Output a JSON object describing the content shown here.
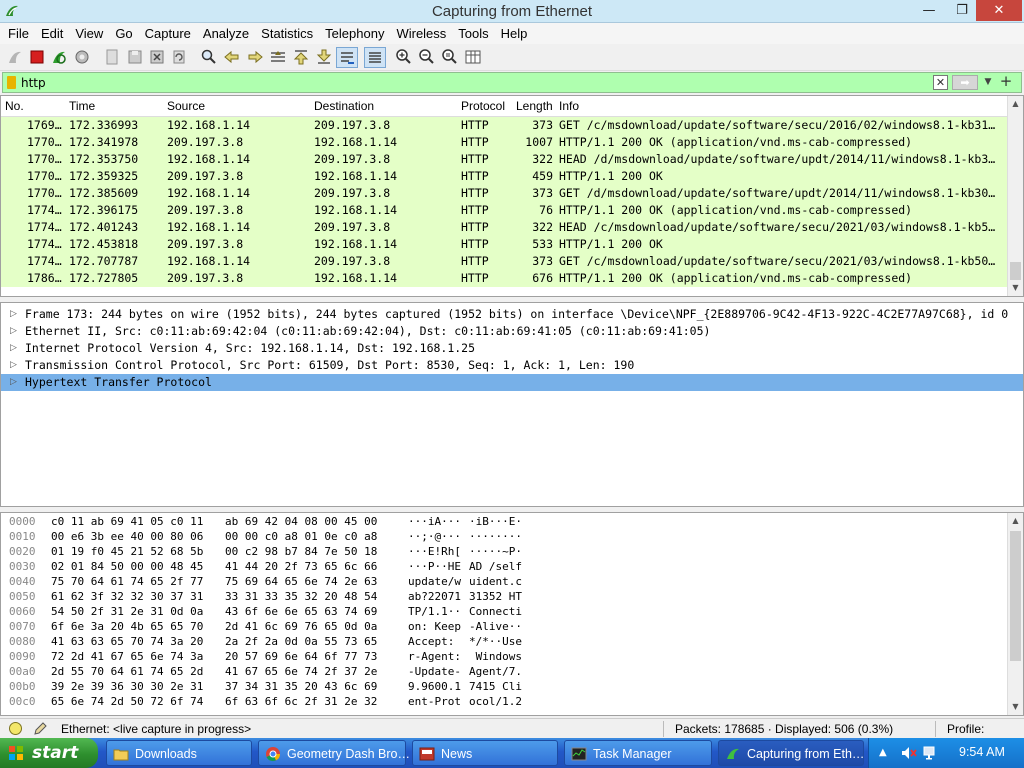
{
  "window": {
    "title": "Capturing from Ethernet",
    "min": "—",
    "max": "❐",
    "close": "✕"
  },
  "menu": [
    "File",
    "Edit",
    "View",
    "Go",
    "Capture",
    "Analyze",
    "Statistics",
    "Telephony",
    "Wireless",
    "Tools",
    "Help"
  ],
  "filter": {
    "value": "http",
    "clear": "✕",
    "apply": "➡",
    "dropdown": "▼",
    "add": "+"
  },
  "columns": {
    "no": "No.",
    "time": "Time",
    "source": "Source",
    "destination": "Destination",
    "protocol": "Protocol",
    "length": "Length",
    "info": "Info"
  },
  "packets": [
    {
      "no": "1769…",
      "time": "172.336993",
      "src": "192.168.1.14",
      "dst": "209.197.3.8",
      "proto": "HTTP",
      "len": "373",
      "info": "GET /c/msdownload/update/software/secu/2016/02/windows8.1-kb31…"
    },
    {
      "no": "1770…",
      "time": "172.341978",
      "src": "209.197.3.8",
      "dst": "192.168.1.14",
      "proto": "HTTP",
      "len": "1007",
      "info": "HTTP/1.1 200 OK  (application/vnd.ms-cab-compressed)"
    },
    {
      "no": "1770…",
      "time": "172.353750",
      "src": "192.168.1.14",
      "dst": "209.197.3.8",
      "proto": "HTTP",
      "len": "322",
      "info": "HEAD /d/msdownload/update/software/updt/2014/11/windows8.1-kb3…"
    },
    {
      "no": "1770…",
      "time": "172.359325",
      "src": "209.197.3.8",
      "dst": "192.168.1.14",
      "proto": "HTTP",
      "len": "459",
      "info": "HTTP/1.1 200 OK"
    },
    {
      "no": "1770…",
      "time": "172.385609",
      "src": "192.168.1.14",
      "dst": "209.197.3.8",
      "proto": "HTTP",
      "len": "373",
      "info": "GET /d/msdownload/update/software/updt/2014/11/windows8.1-kb30…"
    },
    {
      "no": "1774…",
      "time": "172.396175",
      "src": "209.197.3.8",
      "dst": "192.168.1.14",
      "proto": "HTTP",
      "len": "76",
      "info": "HTTP/1.1 200 OK  (application/vnd.ms-cab-compressed)"
    },
    {
      "no": "1774…",
      "time": "172.401243",
      "src": "192.168.1.14",
      "dst": "209.197.3.8",
      "proto": "HTTP",
      "len": "322",
      "info": "HEAD /c/msdownload/update/software/secu/2021/03/windows8.1-kb5…"
    },
    {
      "no": "1774…",
      "time": "172.453818",
      "src": "209.197.3.8",
      "dst": "192.168.1.14",
      "proto": "HTTP",
      "len": "533",
      "info": "HTTP/1.1 200 OK"
    },
    {
      "no": "1774…",
      "time": "172.707787",
      "src": "192.168.1.14",
      "dst": "209.197.3.8",
      "proto": "HTTP",
      "len": "373",
      "info": "GET /c/msdownload/update/software/secu/2021/03/windows8.1-kb50…"
    },
    {
      "no": "1786…",
      "time": "172.727805",
      "src": "209.197.3.8",
      "dst": "192.168.1.14",
      "proto": "HTTP",
      "len": "676",
      "info": "HTTP/1.1 200 OK  (application/vnd.ms-cab-compressed)"
    }
  ],
  "details": [
    {
      "arrow": "▷",
      "text": "Frame 173: 244 bytes on wire (1952 bits), 244 bytes captured (1952 bits) on interface \\Device\\NPF_{2E889706-9C42-4F13-922C-4C2E77A97C68}, id 0",
      "selected": false
    },
    {
      "arrow": "▷",
      "text": "Ethernet II, Src: c0:11:ab:69:42:04 (c0:11:ab:69:42:04), Dst: c0:11:ab:69:41:05 (c0:11:ab:69:41:05)",
      "selected": false
    },
    {
      "arrow": "▷",
      "text": "Internet Protocol Version 4, Src: 192.168.1.14, Dst: 192.168.1.25",
      "selected": false
    },
    {
      "arrow": "▷",
      "text": "Transmission Control Protocol, Src Port: 61509, Dst Port: 8530, Seq: 1, Ack: 1, Len: 190",
      "selected": false
    },
    {
      "arrow": "▷",
      "text": "Hypertext Transfer Protocol",
      "selected": true
    }
  ],
  "hex": [
    {
      "off": "0000",
      "h1": "c0 11 ab 69 41 05 c0 11",
      "h2": "ab 69 42 04 08 00 45 00",
      "a1": "···iA···",
      "a2": "·iB···E·"
    },
    {
      "off": "0010",
      "h1": "00 e6 3b ee 40 00 80 06",
      "h2": "00 00 c0 a8 01 0e c0 a8",
      "a1": "··;·@···",
      "a2": "········"
    },
    {
      "off": "0020",
      "h1": "01 19 f0 45 21 52 68 5b",
      "h2": "00 c2 98 b7 84 7e 50 18",
      "a1": "···E!Rh[",
      "a2": "·····~P·"
    },
    {
      "off": "0030",
      "h1": "02 01 84 50 00 00 48 45",
      "h2": "41 44 20 2f 73 65 6c 66",
      "a1": "···P··HE",
      "a2": "AD /self"
    },
    {
      "off": "0040",
      "h1": "75 70 64 61 74 65 2f 77",
      "h2": "75 69 64 65 6e 74 2e 63",
      "a1": "update/w",
      "a2": "uident.c"
    },
    {
      "off": "0050",
      "h1": "61 62 3f 32 32 30 37 31",
      "h2": "33 31 33 35 32 20 48 54",
      "a1": "ab?22071",
      "a2": "31352 HT"
    },
    {
      "off": "0060",
      "h1": "54 50 2f 31 2e 31 0d 0a",
      "h2": "43 6f 6e 6e 65 63 74 69",
      "a1": "TP/1.1··",
      "a2": "Connecti"
    },
    {
      "off": "0070",
      "h1": "6f 6e 3a 20 4b 65 65 70",
      "h2": "2d 41 6c 69 76 65 0d 0a",
      "a1": "on: Keep",
      "a2": "-Alive··"
    },
    {
      "off": "0080",
      "h1": "41 63 63 65 70 74 3a 20",
      "h2": "2a 2f 2a 0d 0a 55 73 65",
      "a1": "Accept: ",
      "a2": "*/*··Use"
    },
    {
      "off": "0090",
      "h1": "72 2d 41 67 65 6e 74 3a",
      "h2": "20 57 69 6e 64 6f 77 73",
      "a1": "r-Agent:",
      "a2": " Windows"
    },
    {
      "off": "00a0",
      "h1": "2d 55 70 64 61 74 65 2d",
      "h2": "41 67 65 6e 74 2f 37 2e",
      "a1": "-Update-",
      "a2": "Agent/7."
    },
    {
      "off": "00b0",
      "h1": "39 2e 39 36 30 30 2e 31",
      "h2": "37 34 31 35 20 43 6c 69",
      "a1": "9.9600.1",
      "a2": "7415 Cli"
    },
    {
      "off": "00c0",
      "h1": "65 6e 74 2d 50 72 6f 74",
      "h2": "6f 63 6f 6c 2f 31 2e 32",
      "a1": "ent-Prot",
      "a2": "ocol/1.2"
    }
  ],
  "status": {
    "interface": "Ethernet: <live capture in progress>",
    "packets": "Packets: 178685 · Displayed: 506 (0.3%)",
    "profile": "Profile: Default"
  },
  "taskbar": {
    "start": "start",
    "tasks": [
      "Downloads",
      "Geometry Dash Bro…",
      "News",
      "Task Manager",
      "Capturing from Eth…"
    ],
    "clock": "9:54 AM",
    "tray_arrow": "▲"
  },
  "colors": {
    "filter_ok": "#afffaf",
    "http_row": "#e4ffc7",
    "selection": "#77b0e8",
    "close_button": "#c7463d"
  }
}
